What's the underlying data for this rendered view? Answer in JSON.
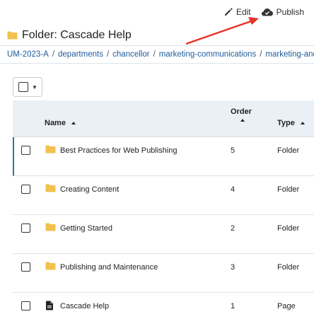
{
  "toolbar": {
    "edit_label": "Edit",
    "publish_label": "Publish"
  },
  "page": {
    "title": "Folder: Cascade Help"
  },
  "breadcrumb": {
    "items": [
      "UM-2023-A",
      "departments",
      "chancellor",
      "marketing-communications",
      "marketing-and-b"
    ],
    "separator": "/"
  },
  "table": {
    "headers": {
      "name": "Name",
      "order": "Order",
      "type": "Type"
    },
    "rows": [
      {
        "name": "Best Practices for Web Publishing",
        "order": "5",
        "type": "Folder",
        "icon": "folder-icon"
      },
      {
        "name": "Creating Content",
        "order": "4",
        "type": "Folder",
        "icon": "folder-icon"
      },
      {
        "name": "Getting Started",
        "order": "2",
        "type": "Folder",
        "icon": "folder-icon"
      },
      {
        "name": "Publishing and Maintenance",
        "order": "3",
        "type": "Folder",
        "icon": "folder-icon"
      },
      {
        "name": "Cascade Help",
        "order": "1",
        "type": "Page",
        "icon": "page-icon"
      }
    ]
  },
  "colors": {
    "link": "#1d5c9c",
    "folder": "#f2c14e",
    "header_bg": "#eaf0f6",
    "annotation_arrow": "#e8312a",
    "active_row_accent": "#2a7a8a"
  }
}
